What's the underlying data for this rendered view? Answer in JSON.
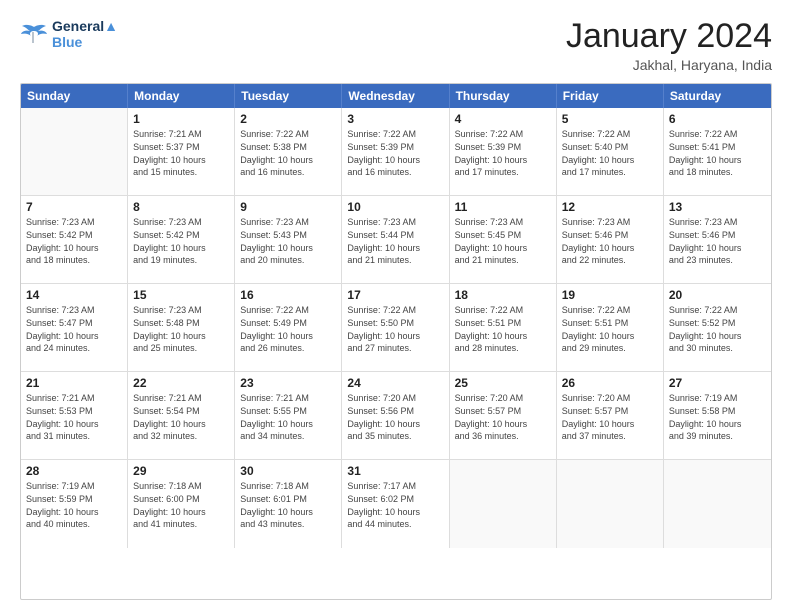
{
  "logo": {
    "line1": "General",
    "line2": "Blue"
  },
  "header": {
    "title": "January 2024",
    "subtitle": "Jakhal, Haryana, India"
  },
  "calendar": {
    "days": [
      "Sunday",
      "Monday",
      "Tuesday",
      "Wednesday",
      "Thursday",
      "Friday",
      "Saturday"
    ],
    "rows": [
      [
        {
          "day": "",
          "lines": []
        },
        {
          "day": "1",
          "lines": [
            "Sunrise: 7:21 AM",
            "Sunset: 5:37 PM",
            "Daylight: 10 hours",
            "and 15 minutes."
          ]
        },
        {
          "day": "2",
          "lines": [
            "Sunrise: 7:22 AM",
            "Sunset: 5:38 PM",
            "Daylight: 10 hours",
            "and 16 minutes."
          ]
        },
        {
          "day": "3",
          "lines": [
            "Sunrise: 7:22 AM",
            "Sunset: 5:39 PM",
            "Daylight: 10 hours",
            "and 16 minutes."
          ]
        },
        {
          "day": "4",
          "lines": [
            "Sunrise: 7:22 AM",
            "Sunset: 5:39 PM",
            "Daylight: 10 hours",
            "and 17 minutes."
          ]
        },
        {
          "day": "5",
          "lines": [
            "Sunrise: 7:22 AM",
            "Sunset: 5:40 PM",
            "Daylight: 10 hours",
            "and 17 minutes."
          ]
        },
        {
          "day": "6",
          "lines": [
            "Sunrise: 7:22 AM",
            "Sunset: 5:41 PM",
            "Daylight: 10 hours",
            "and 18 minutes."
          ]
        }
      ],
      [
        {
          "day": "7",
          "lines": [
            "Sunrise: 7:23 AM",
            "Sunset: 5:42 PM",
            "Daylight: 10 hours",
            "and 18 minutes."
          ]
        },
        {
          "day": "8",
          "lines": [
            "Sunrise: 7:23 AM",
            "Sunset: 5:42 PM",
            "Daylight: 10 hours",
            "and 19 minutes."
          ]
        },
        {
          "day": "9",
          "lines": [
            "Sunrise: 7:23 AM",
            "Sunset: 5:43 PM",
            "Daylight: 10 hours",
            "and 20 minutes."
          ]
        },
        {
          "day": "10",
          "lines": [
            "Sunrise: 7:23 AM",
            "Sunset: 5:44 PM",
            "Daylight: 10 hours",
            "and 21 minutes."
          ]
        },
        {
          "day": "11",
          "lines": [
            "Sunrise: 7:23 AM",
            "Sunset: 5:45 PM",
            "Daylight: 10 hours",
            "and 21 minutes."
          ]
        },
        {
          "day": "12",
          "lines": [
            "Sunrise: 7:23 AM",
            "Sunset: 5:46 PM",
            "Daylight: 10 hours",
            "and 22 minutes."
          ]
        },
        {
          "day": "13",
          "lines": [
            "Sunrise: 7:23 AM",
            "Sunset: 5:46 PM",
            "Daylight: 10 hours",
            "and 23 minutes."
          ]
        }
      ],
      [
        {
          "day": "14",
          "lines": [
            "Sunrise: 7:23 AM",
            "Sunset: 5:47 PM",
            "Daylight: 10 hours",
            "and 24 minutes."
          ]
        },
        {
          "day": "15",
          "lines": [
            "Sunrise: 7:23 AM",
            "Sunset: 5:48 PM",
            "Daylight: 10 hours",
            "and 25 minutes."
          ]
        },
        {
          "day": "16",
          "lines": [
            "Sunrise: 7:22 AM",
            "Sunset: 5:49 PM",
            "Daylight: 10 hours",
            "and 26 minutes."
          ]
        },
        {
          "day": "17",
          "lines": [
            "Sunrise: 7:22 AM",
            "Sunset: 5:50 PM",
            "Daylight: 10 hours",
            "and 27 minutes."
          ]
        },
        {
          "day": "18",
          "lines": [
            "Sunrise: 7:22 AM",
            "Sunset: 5:51 PM",
            "Daylight: 10 hours",
            "and 28 minutes."
          ]
        },
        {
          "day": "19",
          "lines": [
            "Sunrise: 7:22 AM",
            "Sunset: 5:51 PM",
            "Daylight: 10 hours",
            "and 29 minutes."
          ]
        },
        {
          "day": "20",
          "lines": [
            "Sunrise: 7:22 AM",
            "Sunset: 5:52 PM",
            "Daylight: 10 hours",
            "and 30 minutes."
          ]
        }
      ],
      [
        {
          "day": "21",
          "lines": [
            "Sunrise: 7:21 AM",
            "Sunset: 5:53 PM",
            "Daylight: 10 hours",
            "and 31 minutes."
          ]
        },
        {
          "day": "22",
          "lines": [
            "Sunrise: 7:21 AM",
            "Sunset: 5:54 PM",
            "Daylight: 10 hours",
            "and 32 minutes."
          ]
        },
        {
          "day": "23",
          "lines": [
            "Sunrise: 7:21 AM",
            "Sunset: 5:55 PM",
            "Daylight: 10 hours",
            "and 34 minutes."
          ]
        },
        {
          "day": "24",
          "lines": [
            "Sunrise: 7:20 AM",
            "Sunset: 5:56 PM",
            "Daylight: 10 hours",
            "and 35 minutes."
          ]
        },
        {
          "day": "25",
          "lines": [
            "Sunrise: 7:20 AM",
            "Sunset: 5:57 PM",
            "Daylight: 10 hours",
            "and 36 minutes."
          ]
        },
        {
          "day": "26",
          "lines": [
            "Sunrise: 7:20 AM",
            "Sunset: 5:57 PM",
            "Daylight: 10 hours",
            "and 37 minutes."
          ]
        },
        {
          "day": "27",
          "lines": [
            "Sunrise: 7:19 AM",
            "Sunset: 5:58 PM",
            "Daylight: 10 hours",
            "and 39 minutes."
          ]
        }
      ],
      [
        {
          "day": "28",
          "lines": [
            "Sunrise: 7:19 AM",
            "Sunset: 5:59 PM",
            "Daylight: 10 hours",
            "and 40 minutes."
          ]
        },
        {
          "day": "29",
          "lines": [
            "Sunrise: 7:18 AM",
            "Sunset: 6:00 PM",
            "Daylight: 10 hours",
            "and 41 minutes."
          ]
        },
        {
          "day": "30",
          "lines": [
            "Sunrise: 7:18 AM",
            "Sunset: 6:01 PM",
            "Daylight: 10 hours",
            "and 43 minutes."
          ]
        },
        {
          "day": "31",
          "lines": [
            "Sunrise: 7:17 AM",
            "Sunset: 6:02 PM",
            "Daylight: 10 hours",
            "and 44 minutes."
          ]
        },
        {
          "day": "",
          "lines": []
        },
        {
          "day": "",
          "lines": []
        },
        {
          "day": "",
          "lines": []
        }
      ]
    ]
  }
}
